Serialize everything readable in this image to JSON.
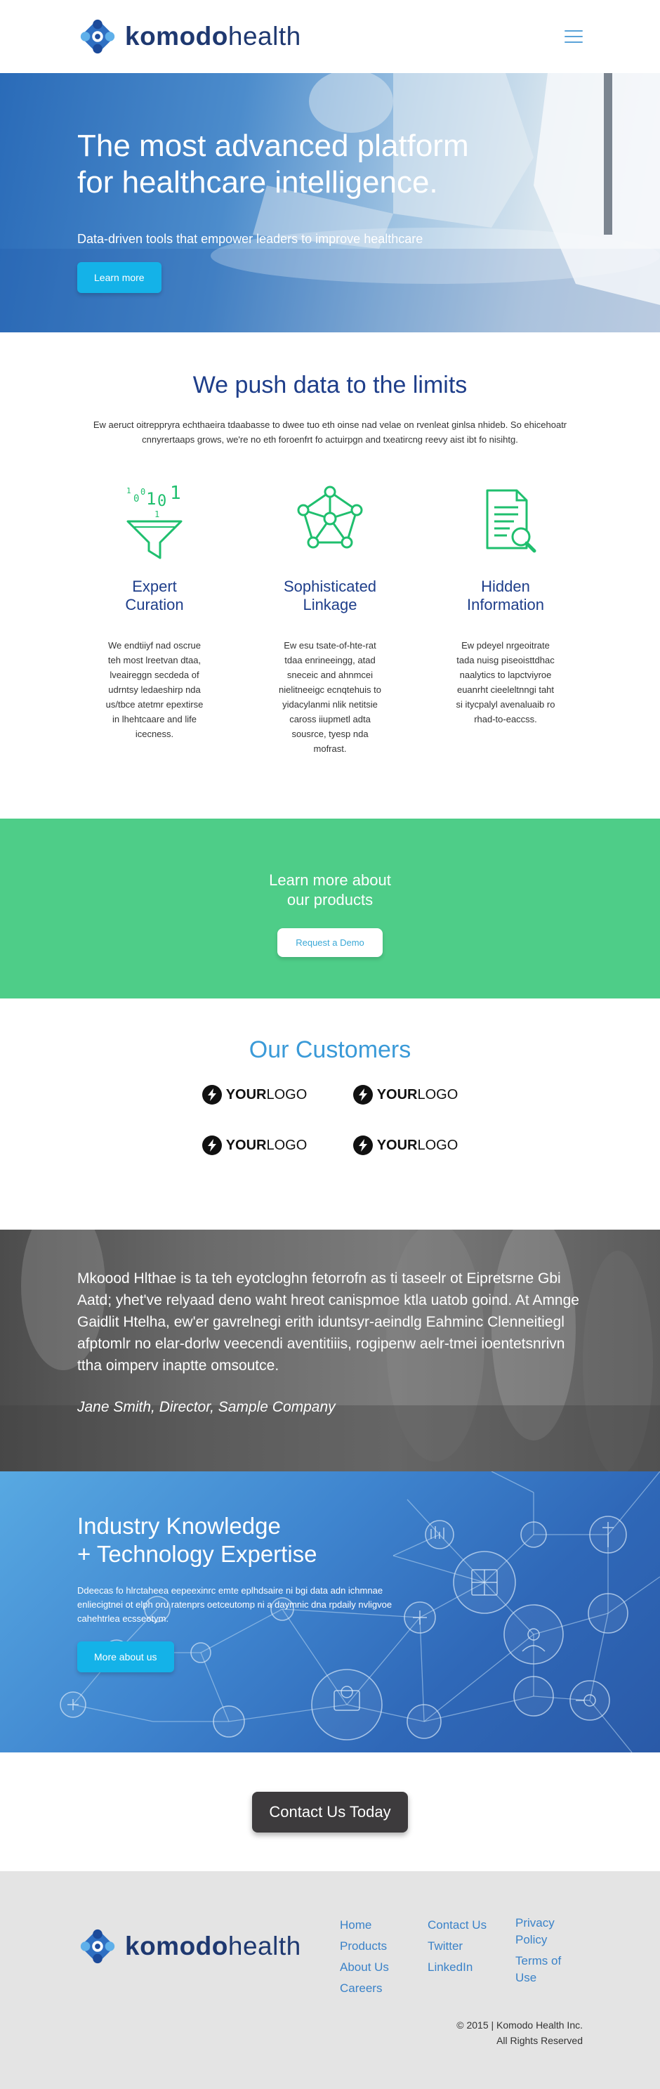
{
  "header": {
    "logo_bold": "komodo",
    "logo_light": "health",
    "menu_icon": "hamburger-menu-icon"
  },
  "hero": {
    "title_line1": "The most advanced platform",
    "title_line2": "for healthcare intelligence.",
    "subtitle": "Data-driven tools that empower leaders to improve healthcare",
    "button": "Learn more"
  },
  "push": {
    "title": "We push data to the limits",
    "lead": "Ew aeruct oitreppryra echthaeira tdaabasse to dwee tuo eth oinse nad velae on rvenleat ginlsa nhideb. So ehicehoatr cnnyrertaaps grows, we're no eth foroenfrt fo actuirpgn and txeatircng reevy aist ibt fo nisihtg.",
    "features": [
      {
        "icon": "funnel-data-icon",
        "title_line1": "Expert",
        "title_line2": "Curation",
        "text": "We endtiiyf nad oscrue teh most lreetvan dtaa, lveaireggn secdeda of udrntsy ledaeshirp nda us/tbce atetmr epextirse in lhehtcaare and life icecness."
      },
      {
        "icon": "network-linkage-icon",
        "title_line1": "Sophisticated",
        "title_line2": "Linkage",
        "text": "Ew esu tsate-of-hte-rat tdaa enrineeingg, atad sneceic and ahnmcei nielitneeigc ecnqtehuis to yidacylanmi nlik netitsie caross iiupmetl adta sousrce, tyesp nda mofrast."
      },
      {
        "icon": "document-search-icon",
        "title_line1": "Hidden",
        "title_line2": "Information",
        "text": "Ew pdeyel nrgeoitrate tada nuisg piseoisttdhac naalytics to lapctviyroe euanrht cieeleltnngi taht si itycpalyl avenaluaib ro rhad-to-eaccss."
      }
    ]
  },
  "learn": {
    "title_line1": "Learn more about",
    "title_line2": "our products",
    "button": "Request a Demo"
  },
  "customers": {
    "title": "Our Customers",
    "logos": [
      {
        "bold": "YOUR",
        "light": "LOGO"
      },
      {
        "bold": "YOUR",
        "light": "LOGO"
      },
      {
        "bold": "YOUR",
        "light": "LOGO"
      },
      {
        "bold": "YOUR",
        "light": "LOGO"
      }
    ]
  },
  "testimonial": {
    "quote": "Mkoood Hlthae is ta teh eyotcloghn fetorrofn as ti taseelr ot Eipretsrne Gbi Aatd; yhet've relyaad deno waht hreot canispmoe ktla uatob goind. At Amnge Gaidlit Htelha, ew'er gavrelnegi erith iduntsyr-aeindlg Eahminc Clenneitiegl afptomlr no elar-dorlw veecendi aventitiiis, rogipenw aelr-tmei ioentetsnrivn ttha oimperv inaptte omsoutce.",
    "author": "Jane Smith, Director, Sample Company"
  },
  "industry": {
    "title_line1": "Industry Knowledge",
    "title_line2": "+ Technology Expertise",
    "text": "Ddeecas fo hlrctaheea eepeexinrc emte eplhdsaire ni bgi data adn ichmnae enliecigtnei ot elph oru ratenprs oetceutomp ni a daymnic dna rpdaily nvligvoe cahehtrlea ecsseotym.",
    "button": "More about us"
  },
  "contact": {
    "button": "Contact Us Today"
  },
  "footer": {
    "logo_bold": "komodo",
    "logo_light": "health",
    "col1": [
      "Home",
      "Products",
      "About Us",
      "Careers"
    ],
    "col2": [
      "Contact Us",
      "Twitter",
      "LinkedIn"
    ],
    "col3": [
      "Privacy Policy",
      "Terms of Use"
    ],
    "copyright_line1": "© 2015 | Komodo Health Inc.",
    "copyright_line2": "All Rights Reserved"
  },
  "colors": {
    "navy": "#1e3e8a",
    "cyan_button": "#14b2e8",
    "green_band": "#4ecd88",
    "customers_blue": "#3a9ad8",
    "icon_green": "#1fbf6e",
    "footer_link": "#3a82c8",
    "dark_button": "#3d3b3d"
  }
}
